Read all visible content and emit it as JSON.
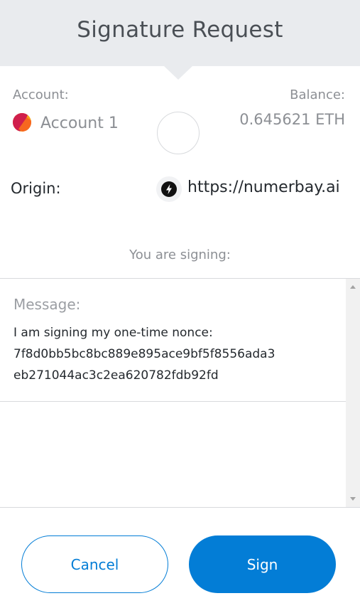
{
  "header": {
    "title": "Signature Request"
  },
  "account": {
    "label": "Account:",
    "name": "Account 1"
  },
  "balance": {
    "label": "Balance:",
    "value": "0.645621 ETH"
  },
  "origin": {
    "label": "Origin:",
    "url": "https://numerbay.ai",
    "icon": "lightning-bolt-icon"
  },
  "signing": {
    "label": "You are signing:"
  },
  "message": {
    "label": "Message:",
    "lines": [
      "I am signing my one-time nonce:",
      "7f8d0bb5bc8bc889e895ace9bf5f8556ada3",
      "eb271044ac3c2ea620782fdb92fd"
    ]
  },
  "actions": {
    "cancel_label": "Cancel",
    "sign_label": "Sign"
  },
  "colors": {
    "primary": "#037dd6",
    "header_bg": "#e9ebee"
  }
}
